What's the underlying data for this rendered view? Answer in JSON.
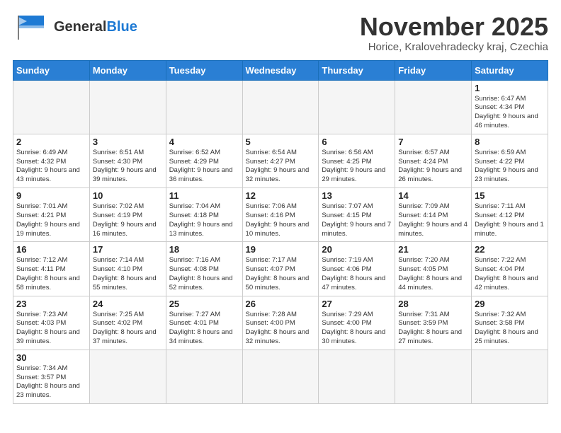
{
  "header": {
    "month_title": "November 2025",
    "subtitle": "Horice, Kralovehradecky kraj, Czechia"
  },
  "days_of_week": [
    "Sunday",
    "Monday",
    "Tuesday",
    "Wednesday",
    "Thursday",
    "Friday",
    "Saturday"
  ],
  "weeks": [
    [
      {
        "day": "",
        "info": ""
      },
      {
        "day": "",
        "info": ""
      },
      {
        "day": "",
        "info": ""
      },
      {
        "day": "",
        "info": ""
      },
      {
        "day": "",
        "info": ""
      },
      {
        "day": "",
        "info": ""
      },
      {
        "day": "1",
        "info": "Sunrise: 6:47 AM\nSunset: 4:34 PM\nDaylight: 9 hours and 46 minutes."
      }
    ],
    [
      {
        "day": "2",
        "info": "Sunrise: 6:49 AM\nSunset: 4:32 PM\nDaylight: 9 hours and 43 minutes."
      },
      {
        "day": "3",
        "info": "Sunrise: 6:51 AM\nSunset: 4:30 PM\nDaylight: 9 hours and 39 minutes."
      },
      {
        "day": "4",
        "info": "Sunrise: 6:52 AM\nSunset: 4:29 PM\nDaylight: 9 hours and 36 minutes."
      },
      {
        "day": "5",
        "info": "Sunrise: 6:54 AM\nSunset: 4:27 PM\nDaylight: 9 hours and 32 minutes."
      },
      {
        "day": "6",
        "info": "Sunrise: 6:56 AM\nSunset: 4:25 PM\nDaylight: 9 hours and 29 minutes."
      },
      {
        "day": "7",
        "info": "Sunrise: 6:57 AM\nSunset: 4:24 PM\nDaylight: 9 hours and 26 minutes."
      },
      {
        "day": "8",
        "info": "Sunrise: 6:59 AM\nSunset: 4:22 PM\nDaylight: 9 hours and 23 minutes."
      }
    ],
    [
      {
        "day": "9",
        "info": "Sunrise: 7:01 AM\nSunset: 4:21 PM\nDaylight: 9 hours and 19 minutes."
      },
      {
        "day": "10",
        "info": "Sunrise: 7:02 AM\nSunset: 4:19 PM\nDaylight: 9 hours and 16 minutes."
      },
      {
        "day": "11",
        "info": "Sunrise: 7:04 AM\nSunset: 4:18 PM\nDaylight: 9 hours and 13 minutes."
      },
      {
        "day": "12",
        "info": "Sunrise: 7:06 AM\nSunset: 4:16 PM\nDaylight: 9 hours and 10 minutes."
      },
      {
        "day": "13",
        "info": "Sunrise: 7:07 AM\nSunset: 4:15 PM\nDaylight: 9 hours and 7 minutes."
      },
      {
        "day": "14",
        "info": "Sunrise: 7:09 AM\nSunset: 4:14 PM\nDaylight: 9 hours and 4 minutes."
      },
      {
        "day": "15",
        "info": "Sunrise: 7:11 AM\nSunset: 4:12 PM\nDaylight: 9 hours and 1 minute."
      }
    ],
    [
      {
        "day": "16",
        "info": "Sunrise: 7:12 AM\nSunset: 4:11 PM\nDaylight: 8 hours and 58 minutes."
      },
      {
        "day": "17",
        "info": "Sunrise: 7:14 AM\nSunset: 4:10 PM\nDaylight: 8 hours and 55 minutes."
      },
      {
        "day": "18",
        "info": "Sunrise: 7:16 AM\nSunset: 4:08 PM\nDaylight: 8 hours and 52 minutes."
      },
      {
        "day": "19",
        "info": "Sunrise: 7:17 AM\nSunset: 4:07 PM\nDaylight: 8 hours and 50 minutes."
      },
      {
        "day": "20",
        "info": "Sunrise: 7:19 AM\nSunset: 4:06 PM\nDaylight: 8 hours and 47 minutes."
      },
      {
        "day": "21",
        "info": "Sunrise: 7:20 AM\nSunset: 4:05 PM\nDaylight: 8 hours and 44 minutes."
      },
      {
        "day": "22",
        "info": "Sunrise: 7:22 AM\nSunset: 4:04 PM\nDaylight: 8 hours and 42 minutes."
      }
    ],
    [
      {
        "day": "23",
        "info": "Sunrise: 7:23 AM\nSunset: 4:03 PM\nDaylight: 8 hours and 39 minutes."
      },
      {
        "day": "24",
        "info": "Sunrise: 7:25 AM\nSunset: 4:02 PM\nDaylight: 8 hours and 37 minutes."
      },
      {
        "day": "25",
        "info": "Sunrise: 7:27 AM\nSunset: 4:01 PM\nDaylight: 8 hours and 34 minutes."
      },
      {
        "day": "26",
        "info": "Sunrise: 7:28 AM\nSunset: 4:00 PM\nDaylight: 8 hours and 32 minutes."
      },
      {
        "day": "27",
        "info": "Sunrise: 7:29 AM\nSunset: 4:00 PM\nDaylight: 8 hours and 30 minutes."
      },
      {
        "day": "28",
        "info": "Sunrise: 7:31 AM\nSunset: 3:59 PM\nDaylight: 8 hours and 27 minutes."
      },
      {
        "day": "29",
        "info": "Sunrise: 7:32 AM\nSunset: 3:58 PM\nDaylight: 8 hours and 25 minutes."
      }
    ],
    [
      {
        "day": "30",
        "info": "Sunrise: 7:34 AM\nSunset: 3:57 PM\nDaylight: 8 hours and 23 minutes."
      },
      {
        "day": "",
        "info": ""
      },
      {
        "day": "",
        "info": ""
      },
      {
        "day": "",
        "info": ""
      },
      {
        "day": "",
        "info": ""
      },
      {
        "day": "",
        "info": ""
      },
      {
        "day": "",
        "info": ""
      }
    ]
  ],
  "logo": {
    "text_general": "General",
    "text_blue": "Blue"
  }
}
